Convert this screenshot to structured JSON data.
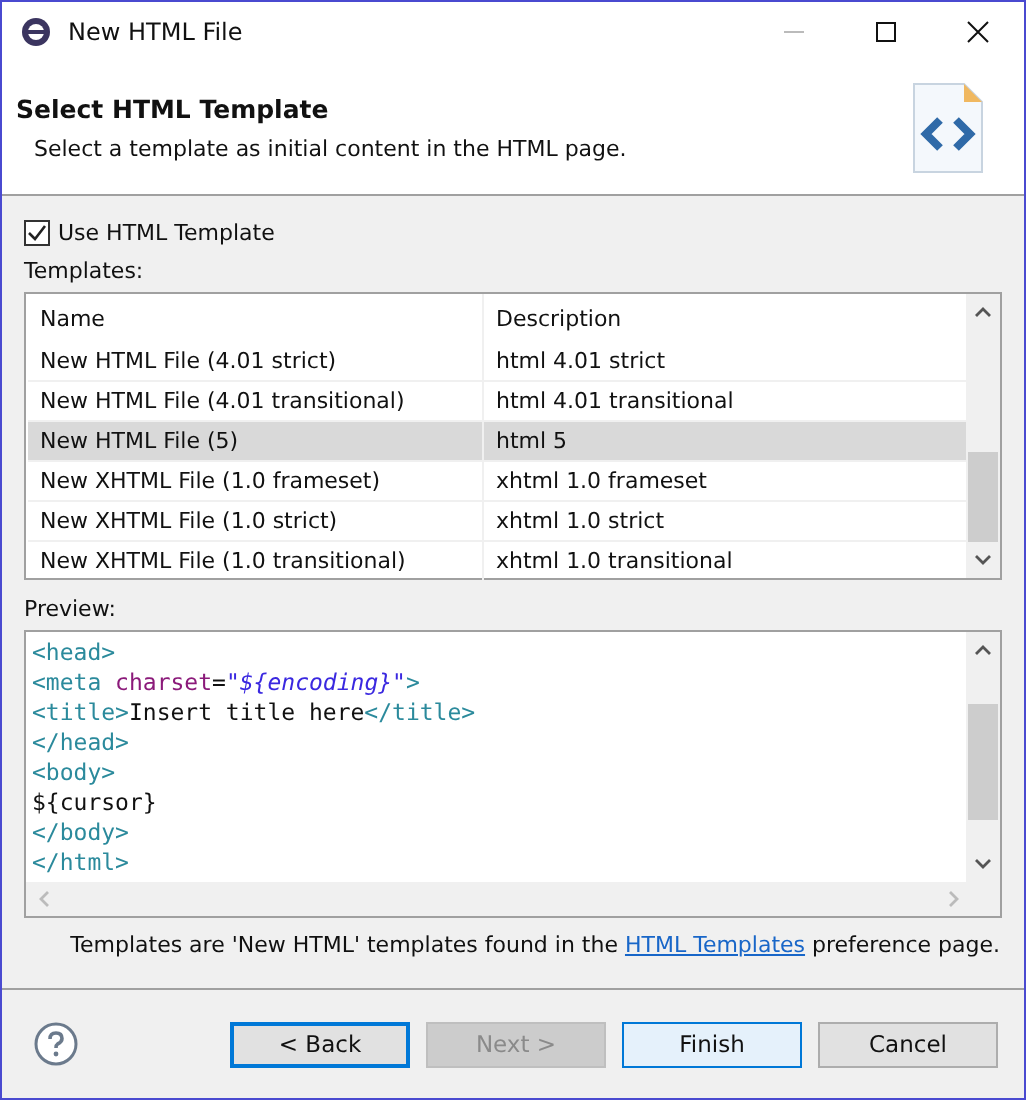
{
  "window": {
    "title": "New HTML File"
  },
  "header": {
    "title": "Select HTML Template",
    "description": "Select a template as initial content in the HTML page."
  },
  "use_template": {
    "label": "Use HTML Template",
    "checked": true
  },
  "templates": {
    "label": "Templates:",
    "columns": [
      "Name",
      "Description"
    ],
    "rows": [
      {
        "name": "New HTML File (4.01 strict)",
        "description": "html 4.01 strict",
        "selected": false
      },
      {
        "name": "New HTML File (4.01 transitional)",
        "description": "html 4.01 transitional",
        "selected": false
      },
      {
        "name": "New HTML File (5)",
        "description": "html 5",
        "selected": true
      },
      {
        "name": "New XHTML File (1.0 frameset)",
        "description": "xhtml 1.0 frameset",
        "selected": false
      },
      {
        "name": "New XHTML File (1.0 strict)",
        "description": "xhtml 1.0 strict",
        "selected": false
      },
      {
        "name": "New XHTML File (1.0 transitional)",
        "description": "xhtml 1.0 transitional",
        "selected": false
      }
    ]
  },
  "preview": {
    "label": "Preview:",
    "lines": [
      [
        {
          "kind": "tag",
          "text": "<head>"
        }
      ],
      [
        {
          "kind": "tag",
          "text": "<meta"
        },
        {
          "kind": "attr",
          "text": " charset"
        },
        {
          "kind": "text",
          "text": "="
        },
        {
          "kind": "string",
          "text": "\"${encoding}\""
        },
        {
          "kind": "tag",
          "text": ">"
        }
      ],
      [
        {
          "kind": "tag",
          "text": "<title>"
        },
        {
          "kind": "text",
          "text": "Insert title here"
        },
        {
          "kind": "tag",
          "text": "</title>"
        }
      ],
      [
        {
          "kind": "tag",
          "text": "</head>"
        }
      ],
      [
        {
          "kind": "tag",
          "text": "<body>"
        }
      ],
      [
        {
          "kind": "text",
          "text": "${cursor}"
        }
      ],
      [
        {
          "kind": "tag",
          "text": "</body>"
        }
      ],
      [
        {
          "kind": "tag",
          "text": "</html>"
        }
      ]
    ]
  },
  "footer_note": {
    "before": "Templates are 'New HTML' templates found in the ",
    "link": "HTML Templates",
    "after": " preference page."
  },
  "buttons": [
    {
      "label": "< Back",
      "kind": "focused",
      "disabled": false
    },
    {
      "label": "Next >",
      "kind": "normal",
      "disabled": true
    },
    {
      "label": "Finish",
      "kind": "default",
      "disabled": false
    },
    {
      "label": "Cancel",
      "kind": "normal",
      "disabled": false
    }
  ]
}
